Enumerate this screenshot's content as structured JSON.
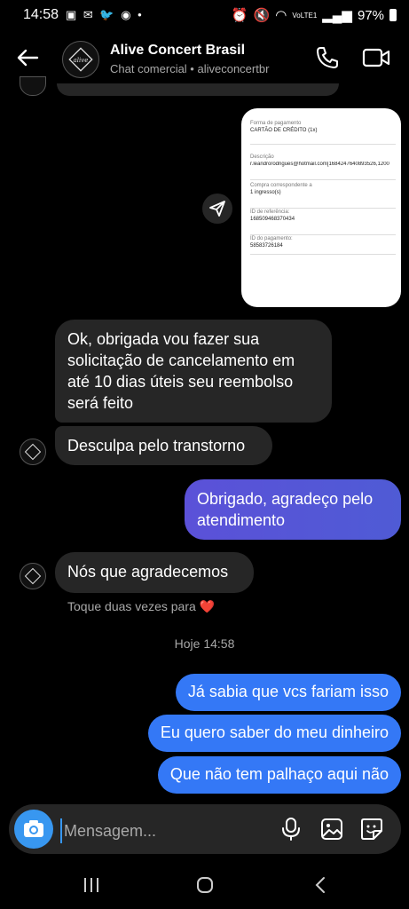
{
  "status_bar": {
    "time": "14:58",
    "battery": "97%",
    "network": "VoLTE1"
  },
  "header": {
    "title": "Alive Concert Brasil",
    "subtitle": "Chat comercial • aliveconcertbr"
  },
  "shared_image": {
    "rows": [
      {
        "label": "Forma de pagamento",
        "value": "CARTÃO DE CRÉDITO (1x)"
      },
      {
        "label": "Descrição",
        "value": "r.leandrorodrigues@hotmail.com[1684247640893526,1200"
      },
      {
        "label": "Compra correspondente a",
        "value": "1 ingresso(s)"
      },
      {
        "label": "ID de referência:",
        "value": "16850946837043​4"
      },
      {
        "label": "ID do pagamento:",
        "value": "58583726184"
      }
    ]
  },
  "messages": {
    "m1": "Ok, obrigada vou fazer sua solicitação de cancelamento em até 10 dias úteis seu reembolso será feito",
    "m2": "Desculpa pelo transtorno",
    "m3": "Obrigado, agradeço pelo atendimento",
    "m4": "Nós que agradecemos",
    "hint": "Toque duas vezes para ❤️",
    "timestamp": "Hoje 14:58",
    "m5": "Já sabia que vcs fariam isso",
    "m6": "Eu quero saber do meu dinheiro",
    "m7": "Que não tem palhaço aqui não"
  },
  "composer": {
    "placeholder": "Mensagem..."
  },
  "colors": {
    "accent_blue": "#3478f6",
    "purple": "#5b51d8",
    "incoming": "#262626"
  }
}
